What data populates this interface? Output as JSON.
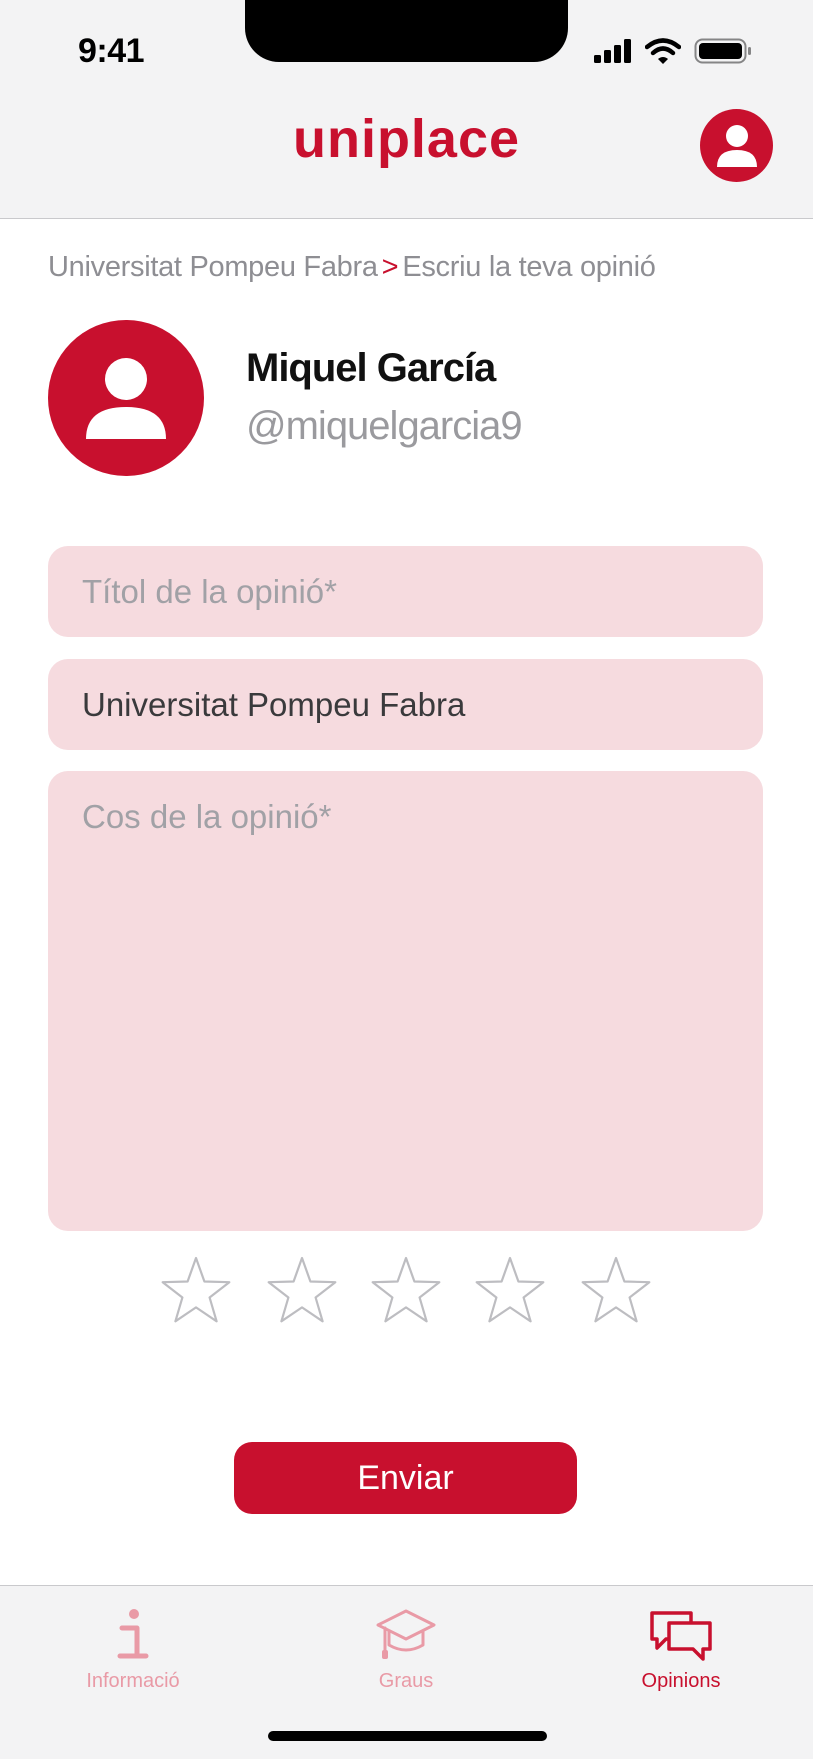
{
  "status_bar": {
    "time": "9:41"
  },
  "header": {
    "brand": "uniplace",
    "profile_icon": "person-icon"
  },
  "breadcrumb": {
    "parent": "Universitat Pompeu Fabra",
    "separator": ">",
    "current": "Escriu la teva opinió"
  },
  "user": {
    "name": "Miquel García",
    "handle": "@miquelgarcia9",
    "avatar_icon": "person-icon"
  },
  "form": {
    "title_placeholder": "Títol de la opinió*",
    "university_value": "Universitat Pompeu Fabra",
    "body_placeholder": "Cos de la opinió*",
    "rating": {
      "value": 0,
      "max": 5,
      "icon": "star-outline-icon"
    },
    "submit_label": "Enviar"
  },
  "tabs": [
    {
      "label": "Informació",
      "icon": "info-icon",
      "active": false
    },
    {
      "label": "Graus",
      "icon": "graduation-cap-icon",
      "active": false
    },
    {
      "label": "Opinions",
      "icon": "chat-bubbles-icon",
      "active": true
    }
  ],
  "colors": {
    "accent": "#c8102e",
    "field_bg": "#f6dbdf",
    "bar_bg": "#f3f3f4",
    "inactive_tab": "#e99aa6",
    "muted_text": "#8e8e93"
  }
}
